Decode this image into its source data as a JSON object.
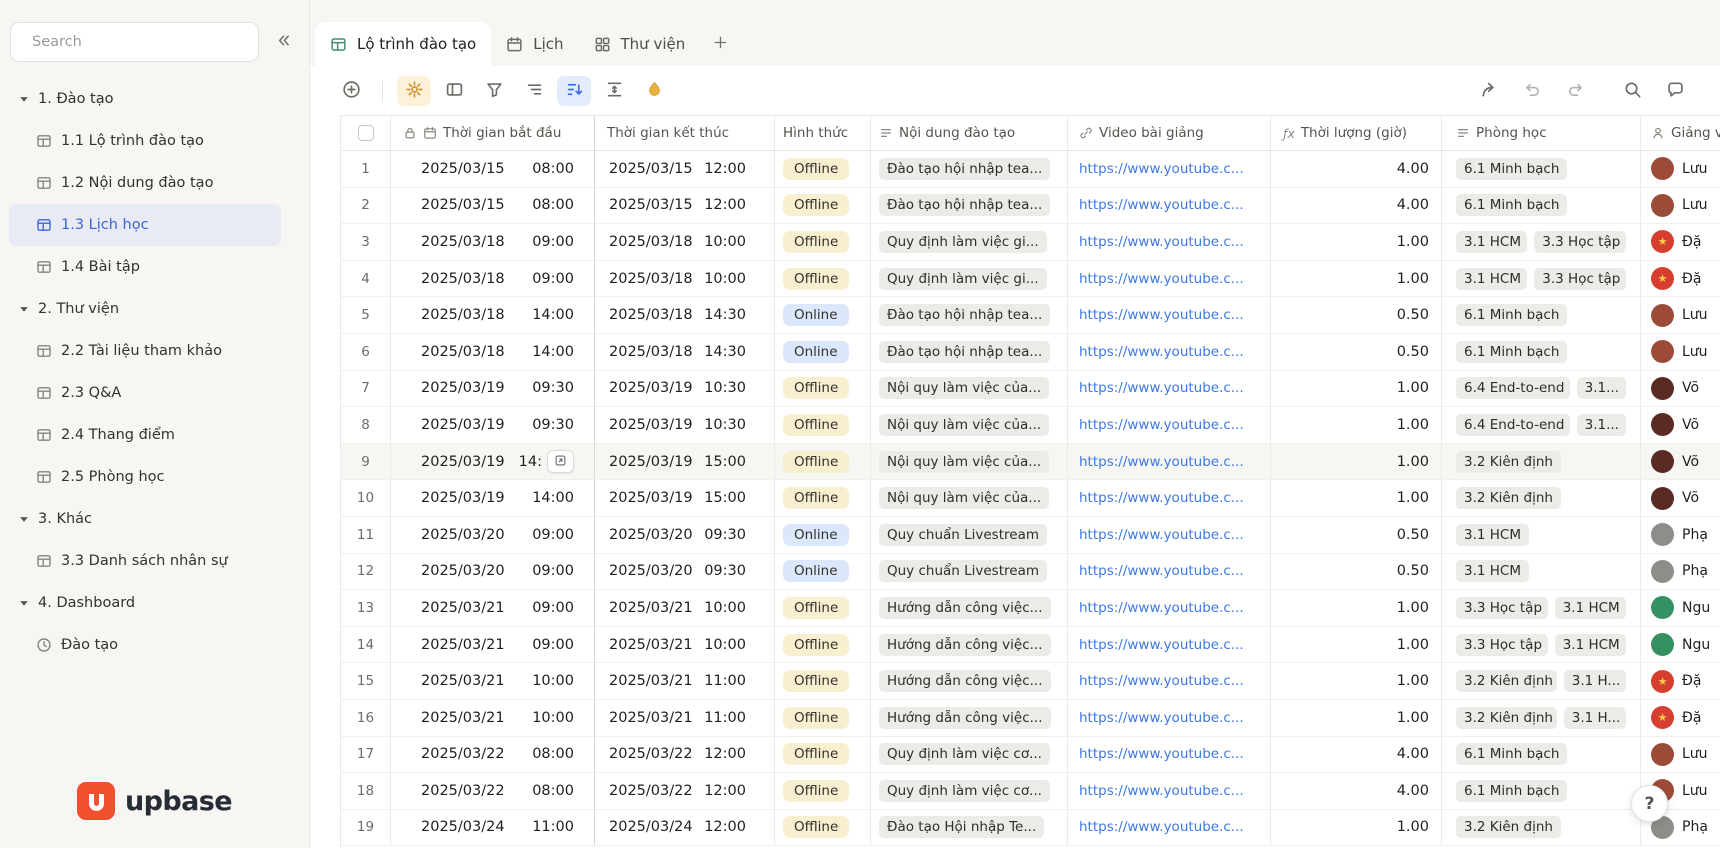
{
  "app": {
    "help_label": "?"
  },
  "colors": {
    "accent": "#3c63d8",
    "offline_bg": "#f8eed0",
    "online_bg": "#dbe7fb",
    "chip_bg": "#ebebe8",
    "link": "#3e78e0",
    "logo_orange": "#f1502f",
    "toolbar_active_orange": "#fdf1d8",
    "toolbar_active_blue": "#e4ecfc"
  },
  "sidebar": {
    "search_placeholder": "Search",
    "logo_text": "upbase",
    "sections": [
      {
        "label": "1. Đào tạo",
        "children": [
          {
            "label": "1.1 Lộ trình đào tạo",
            "icon": "table"
          },
          {
            "label": "1.2 Nội dung đào tạo",
            "icon": "table"
          },
          {
            "label": "1.3 Lịch học",
            "icon": "table",
            "selected": true
          },
          {
            "label": "1.4 Bài tập",
            "icon": "table"
          }
        ]
      },
      {
        "label": "2. Thư viện",
        "children": [
          {
            "label": "2.2 Tài liệu tham khảo",
            "icon": "table"
          },
          {
            "label": "2.3 Q&A",
            "icon": "table"
          },
          {
            "label": "2.4 Thang điểm",
            "icon": "table"
          },
          {
            "label": "2.5 Phòng học",
            "icon": "table"
          }
        ]
      },
      {
        "label": "3. Khác",
        "children": [
          {
            "label": "3.3 Danh sách nhân sự",
            "icon": "table"
          }
        ]
      },
      {
        "label": "4. Dashboard",
        "children": [
          {
            "label": "Đào tạo",
            "icon": "clock"
          }
        ]
      }
    ]
  },
  "tabs": [
    {
      "label": "Lộ trình đào tạo",
      "icon": "table",
      "active": true
    },
    {
      "label": "Lịch",
      "icon": "calendar",
      "active": false
    },
    {
      "label": "Thư viện",
      "icon": "grid",
      "active": false
    }
  ],
  "toolbar": {
    "left": [
      {
        "name": "add-record",
        "icon": "plus-circle"
      },
      {
        "name": "divider"
      },
      {
        "name": "view-settings",
        "icon": "gear",
        "state": "orange"
      },
      {
        "name": "hide-fields",
        "icon": "hide-fields"
      },
      {
        "name": "filter",
        "icon": "funnel"
      },
      {
        "name": "group",
        "icon": "group"
      },
      {
        "name": "sort",
        "icon": "sort",
        "state": "blue"
      },
      {
        "name": "row-height",
        "icon": "row-height"
      },
      {
        "name": "color",
        "icon": "paint"
      }
    ],
    "right": [
      {
        "name": "share",
        "icon": "share"
      },
      {
        "name": "undo",
        "icon": "undo",
        "muted": true
      },
      {
        "name": "redo",
        "icon": "redo",
        "muted": true
      },
      {
        "name": "search-records",
        "icon": "magnifier",
        "gap": true
      },
      {
        "name": "comments",
        "icon": "comment"
      }
    ]
  },
  "table": {
    "columns": [
      {
        "label": "Thời gian bắt đầu",
        "icons": [
          "lock",
          "calendar"
        ]
      },
      {
        "label": "Thời gian kết thúc",
        "icons": []
      },
      {
        "label": "Hình thức",
        "icons": []
      },
      {
        "label": "Nội dung đào tạo",
        "icons": [
          "text"
        ]
      },
      {
        "label": "Video bài giảng",
        "icons": [
          "link"
        ]
      },
      {
        "label": "Thời lượng (giờ)",
        "icons": [
          "fx"
        ]
      },
      {
        "label": "Phòng học",
        "icons": [
          "text"
        ]
      },
      {
        "label": "Giảng viên",
        "icons": [
          "person"
        ]
      }
    ],
    "rows": [
      {
        "num": "1",
        "start_date": "2025/03/15",
        "start_time": "08:00",
        "end_date": "2025/03/15",
        "end_time": "12:00",
        "mode": "Offline",
        "content": "Đào tạo hội nhập tea...",
        "video": "https://www.youtube.c...",
        "duration": "4.00",
        "rooms": [
          "6.1 Minh bạch"
        ],
        "teacher": "Lưu",
        "avatar_color": "#9c4b39"
      },
      {
        "num": "2",
        "start_date": "2025/03/15",
        "start_time": "08:00",
        "end_date": "2025/03/15",
        "end_time": "12:00",
        "mode": "Offline",
        "content": "Đào tạo hội nhập tea...",
        "video": "https://www.youtube.c...",
        "duration": "4.00",
        "rooms": [
          "6.1 Minh bạch"
        ],
        "teacher": "Lưu",
        "avatar_color": "#9c4b39"
      },
      {
        "num": "3",
        "start_date": "2025/03/18",
        "start_time": "09:00",
        "end_date": "2025/03/18",
        "end_time": "10:00",
        "mode": "Offline",
        "content": "Quy định làm việc gi...",
        "video": "https://www.youtube.c...",
        "duration": "1.00",
        "rooms": [
          "3.1 HCM",
          "3.3 Học tập"
        ],
        "teacher": "Đặ",
        "avatar_color": "#d63f2f",
        "avatar_star": true
      },
      {
        "num": "4",
        "start_date": "2025/03/18",
        "start_time": "09:00",
        "end_date": "2025/03/18",
        "end_time": "10:00",
        "mode": "Offline",
        "content": "Quy định làm việc gi...",
        "video": "https://www.youtube.c...",
        "duration": "1.00",
        "rooms": [
          "3.1 HCM",
          "3.3 Học tập"
        ],
        "teacher": "Đặ",
        "avatar_color": "#d63f2f",
        "avatar_star": true
      },
      {
        "num": "5",
        "start_date": "2025/03/18",
        "start_time": "14:00",
        "end_date": "2025/03/18",
        "end_time": "14:30",
        "mode": "Online",
        "content": "Đào tạo hội nhập tea...",
        "video": "https://www.youtube.c...",
        "duration": "0.50",
        "rooms": [
          "6.1 Minh bạch"
        ],
        "teacher": "Lưu",
        "avatar_color": "#9c4b39"
      },
      {
        "num": "6",
        "start_date": "2025/03/18",
        "start_time": "14:00",
        "end_date": "2025/03/18",
        "end_time": "14:30",
        "mode": "Online",
        "content": "Đào tạo hội nhập tea...",
        "video": "https://www.youtube.c...",
        "duration": "0.50",
        "rooms": [
          "6.1 Minh bạch"
        ],
        "teacher": "Lưu",
        "avatar_color": "#9c4b39"
      },
      {
        "num": "7",
        "start_date": "2025/03/19",
        "start_time": "09:30",
        "end_date": "2025/03/19",
        "end_time": "10:30",
        "mode": "Offline",
        "content": "Nội quy làm việc của...",
        "video": "https://www.youtube.c...",
        "duration": "1.00",
        "rooms": [
          "6.4 End-to-end",
          "3.1..."
        ],
        "teacher": "Võ",
        "avatar_color": "#5a2a24"
      },
      {
        "num": "8",
        "start_date": "2025/03/19",
        "start_time": "09:30",
        "end_date": "2025/03/19",
        "end_time": "10:30",
        "mode": "Offline",
        "content": "Nội quy làm việc của...",
        "video": "https://www.youtube.c...",
        "duration": "1.00",
        "rooms": [
          "6.4 End-to-end",
          "3.1..."
        ],
        "teacher": "Võ",
        "avatar_color": "#5a2a24"
      },
      {
        "num": "9",
        "start_date": "2025/03/19",
        "start_time": "14:",
        "end_date": "2025/03/19",
        "end_time": "15:00",
        "mode": "Offline",
        "content": "Nội quy làm việc của...",
        "video": "https://www.youtube.c...",
        "duration": "1.00",
        "rooms": [
          "3.2 Kiên định"
        ],
        "teacher": "Võ",
        "avatar_color": "#5a2a24",
        "hovered": true,
        "expand": true
      },
      {
        "num": "10",
        "start_date": "2025/03/19",
        "start_time": "14:00",
        "end_date": "2025/03/19",
        "end_time": "15:00",
        "mode": "Offline",
        "content": "Nội quy làm việc của...",
        "video": "https://www.youtube.c...",
        "duration": "1.00",
        "rooms": [
          "3.2 Kiên định"
        ],
        "teacher": "Võ",
        "avatar_color": "#5a2a24"
      },
      {
        "num": "11",
        "start_date": "2025/03/20",
        "start_time": "09:00",
        "end_date": "2025/03/20",
        "end_time": "09:30",
        "mode": "Online",
        "content": "Quy chuẩn Livestream",
        "video": "https://www.youtube.c...",
        "duration": "0.50",
        "rooms": [
          "3.1 HCM"
        ],
        "teacher": "Phạ",
        "avatar_color": "#8e8d89"
      },
      {
        "num": "12",
        "start_date": "2025/03/20",
        "start_time": "09:00",
        "end_date": "2025/03/20",
        "end_time": "09:30",
        "mode": "Online",
        "content": "Quy chuẩn Livestream",
        "video": "https://www.youtube.c...",
        "duration": "0.50",
        "rooms": [
          "3.1 HCM"
        ],
        "teacher": "Phạ",
        "avatar_color": "#8e8d89"
      },
      {
        "num": "13",
        "start_date": "2025/03/21",
        "start_time": "09:00",
        "end_date": "2025/03/21",
        "end_time": "10:00",
        "mode": "Offline",
        "content": "Hướng dẫn công việc...",
        "video": "https://www.youtube.c...",
        "duration": "1.00",
        "rooms": [
          "3.3 Học tập",
          "3.1 HCM"
        ],
        "teacher": "Ngu",
        "avatar_color": "#359062"
      },
      {
        "num": "14",
        "start_date": "2025/03/21",
        "start_time": "09:00",
        "end_date": "2025/03/21",
        "end_time": "10:00",
        "mode": "Offline",
        "content": "Hướng dẫn công việc...",
        "video": "https://www.youtube.c...",
        "duration": "1.00",
        "rooms": [
          "3.3 Học tập",
          "3.1 HCM"
        ],
        "teacher": "Ngu",
        "avatar_color": "#359062"
      },
      {
        "num": "15",
        "start_date": "2025/03/21",
        "start_time": "10:00",
        "end_date": "2025/03/21",
        "end_time": "11:00",
        "mode": "Offline",
        "content": "Hướng dẫn công việc...",
        "video": "https://www.youtube.c...",
        "duration": "1.00",
        "rooms": [
          "3.2 Kiên định",
          "3.1 H..."
        ],
        "teacher": "Đặ",
        "avatar_color": "#d63f2f",
        "avatar_star": true
      },
      {
        "num": "16",
        "start_date": "2025/03/21",
        "start_time": "10:00",
        "end_date": "2025/03/21",
        "end_time": "11:00",
        "mode": "Offline",
        "content": "Hướng dẫn công việc...",
        "video": "https://www.youtube.c...",
        "duration": "1.00",
        "rooms": [
          "3.2 Kiên định",
          "3.1 H..."
        ],
        "teacher": "Đặ",
        "avatar_color": "#d63f2f",
        "avatar_star": true
      },
      {
        "num": "17",
        "start_date": "2025/03/22",
        "start_time": "08:00",
        "end_date": "2025/03/22",
        "end_time": "12:00",
        "mode": "Offline",
        "content": "Quy định làm việc cơ...",
        "video": "https://www.youtube.c...",
        "duration": "4.00",
        "rooms": [
          "6.1 Minh bạch"
        ],
        "teacher": "Lưu",
        "avatar_color": "#9c4b39"
      },
      {
        "num": "18",
        "start_date": "2025/03/22",
        "start_time": "08:00",
        "end_date": "2025/03/22",
        "end_time": "12:00",
        "mode": "Offline",
        "content": "Quy định làm việc cơ...",
        "video": "https://www.youtube.c...",
        "duration": "4.00",
        "rooms": [
          "6.1 Minh bạch"
        ],
        "teacher": "Lưu",
        "avatar_color": "#9c4b39"
      },
      {
        "num": "19",
        "start_date": "2025/03/24",
        "start_time": "11:00",
        "end_date": "2025/03/24",
        "end_time": "12:00",
        "mode": "Offline",
        "content": "Đào tạo Hội nhập Te...",
        "video": "https://www.youtube.c...",
        "duration": "1.00",
        "rooms": [
          "3.2 Kiên định"
        ],
        "teacher": "Phạ",
        "avatar_color": "#8e8d89"
      }
    ]
  }
}
